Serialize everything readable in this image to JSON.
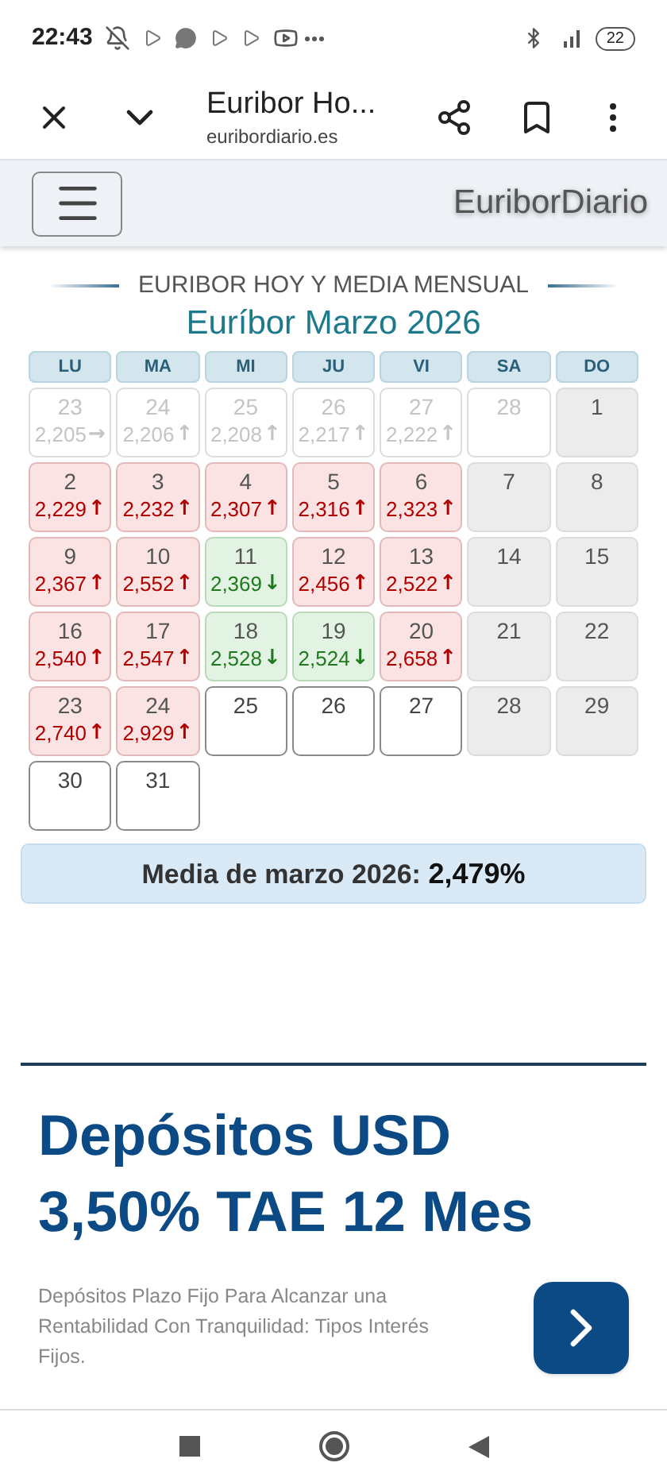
{
  "status_bar": {
    "time": "22:43",
    "battery": "22"
  },
  "browser": {
    "title": "Euribor Ho...",
    "url": "euribordiario.es"
  },
  "site": {
    "brand": "EuriborDiario"
  },
  "section_heading": "EURIBOR HOY Y MEDIA MENSUAL",
  "calendar": {
    "title": "Euríbor Marzo 2026",
    "weekdays": [
      "LU",
      "MA",
      "MI",
      "JU",
      "VI",
      "SA",
      "DO"
    ],
    "weeks": [
      [
        {
          "day": "23",
          "value": "2,205",
          "arrow": "→",
          "kind": "prev_month"
        },
        {
          "day": "24",
          "value": "2,206",
          "arrow": "↑",
          "kind": "prev_month"
        },
        {
          "day": "25",
          "value": "2,208",
          "arrow": "↑",
          "kind": "prev_month"
        },
        {
          "day": "26",
          "value": "2,217",
          "arrow": "↑",
          "kind": "prev_month"
        },
        {
          "day": "27",
          "value": "2,222",
          "arrow": "↑",
          "kind": "prev_month"
        },
        {
          "day": "28",
          "kind": "prev_month"
        },
        {
          "day": "1",
          "kind": "weekend"
        }
      ],
      [
        {
          "day": "2",
          "value": "2,229",
          "arrow": "↑",
          "kind": "rise"
        },
        {
          "day": "3",
          "value": "2,232",
          "arrow": "↑",
          "kind": "rise"
        },
        {
          "day": "4",
          "value": "2,307",
          "arrow": "↑",
          "kind": "rise"
        },
        {
          "day": "5",
          "value": "2,316",
          "arrow": "↑",
          "kind": "rise"
        },
        {
          "day": "6",
          "value": "2,323",
          "arrow": "↑",
          "kind": "rise"
        },
        {
          "day": "7",
          "kind": "weekend"
        },
        {
          "day": "8",
          "kind": "weekend"
        }
      ],
      [
        {
          "day": "9",
          "value": "2,367",
          "arrow": "↑",
          "kind": "rise"
        },
        {
          "day": "10",
          "value": "2,552",
          "arrow": "↑",
          "kind": "rise"
        },
        {
          "day": "11",
          "value": "2,369",
          "arrow": "↓",
          "kind": "fall"
        },
        {
          "day": "12",
          "value": "2,456",
          "arrow": "↑",
          "kind": "rise"
        },
        {
          "day": "13",
          "value": "2,522",
          "arrow": "↑",
          "kind": "rise"
        },
        {
          "day": "14",
          "kind": "weekend"
        },
        {
          "day": "15",
          "kind": "weekend"
        }
      ],
      [
        {
          "day": "16",
          "value": "2,540",
          "arrow": "↑",
          "kind": "rise"
        },
        {
          "day": "17",
          "value": "2,547",
          "arrow": "↑",
          "kind": "rise"
        },
        {
          "day": "18",
          "value": "2,528",
          "arrow": "↓",
          "kind": "fall"
        },
        {
          "day": "19",
          "value": "2,524",
          "arrow": "↓",
          "kind": "fall"
        },
        {
          "day": "20",
          "value": "2,658",
          "arrow": "↑",
          "kind": "rise"
        },
        {
          "day": "21",
          "kind": "weekend"
        },
        {
          "day": "22",
          "kind": "weekend"
        }
      ],
      [
        {
          "day": "23",
          "value": "2,740",
          "arrow": "↑",
          "kind": "rise"
        },
        {
          "day": "24",
          "value": "2,929",
          "arrow": "↑",
          "kind": "rise"
        },
        {
          "day": "25",
          "kind": "pending"
        },
        {
          "day": "26",
          "kind": "pending"
        },
        {
          "day": "27",
          "kind": "pending"
        },
        {
          "day": "28",
          "kind": "weekend"
        },
        {
          "day": "29",
          "kind": "weekend"
        }
      ],
      [
        {
          "day": "30",
          "kind": "pending"
        },
        {
          "day": "31",
          "kind": "pending"
        }
      ]
    ],
    "average_label": "Media de marzo 2026:",
    "average_value": "2,479%"
  },
  "ad": {
    "headline": "Depósitos USD 3,50% TAE 12 Mes",
    "body": "Depósitos Plazo Fijo Para Alcanzar una Rentabilidad Con Tranquilidad: Tipos Interés Fijos."
  }
}
